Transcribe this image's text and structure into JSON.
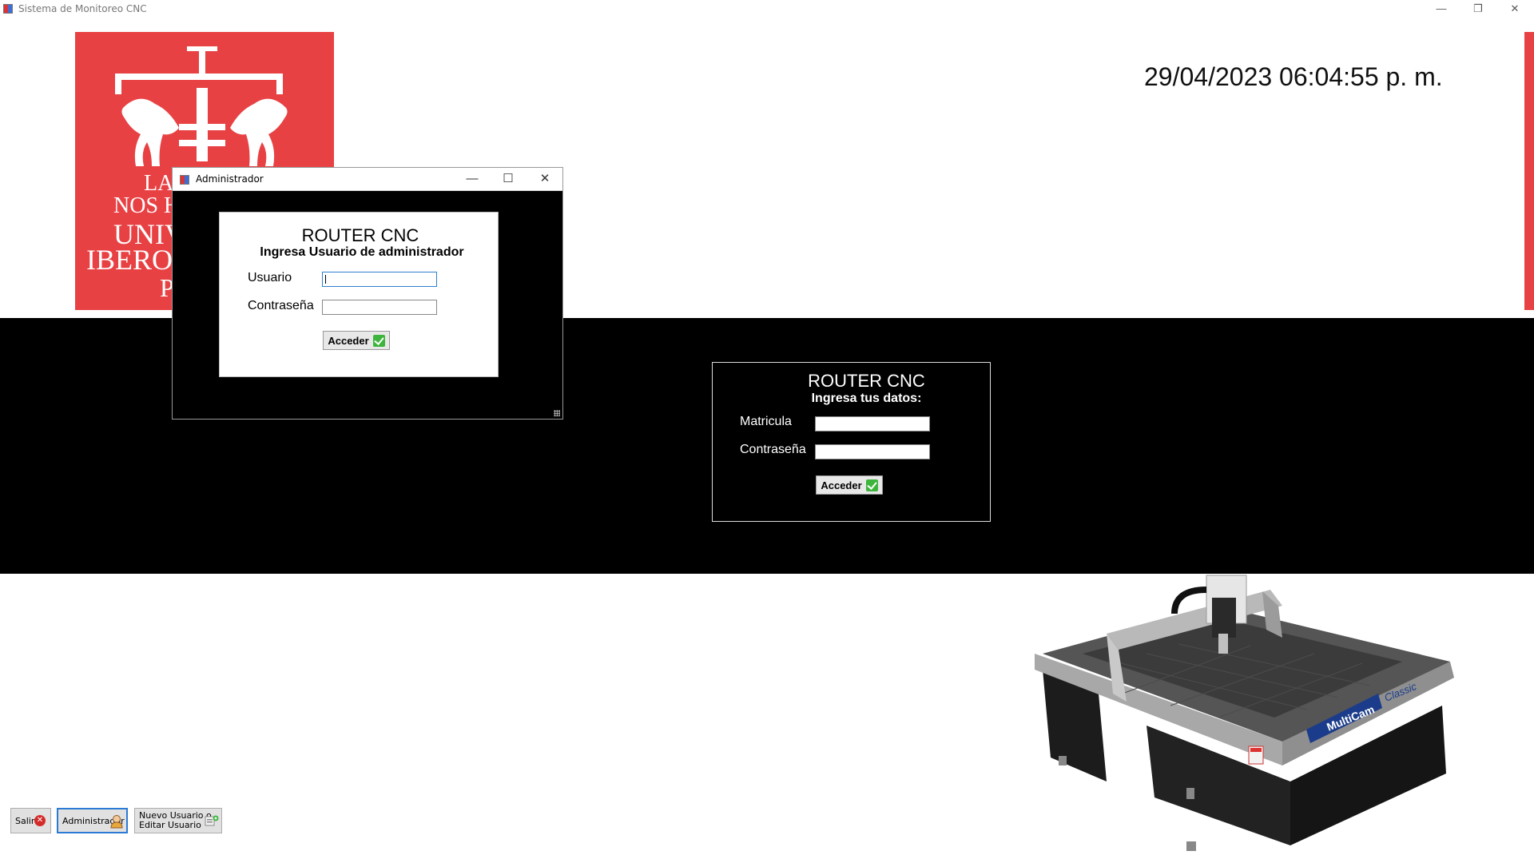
{
  "window": {
    "title": "Sistema de Monitoreo CNC",
    "minimize": "—",
    "restore": "❐",
    "close": "✕"
  },
  "logo": {
    "lines": [
      "LA",
      "NOS H",
      "UNIV",
      "IBEROA",
      "P"
    ]
  },
  "datetime": "29/04/2023 06:04:55 p. m.",
  "login": {
    "title": "ROUTER CNC",
    "subtitle": "Ingresa tus datos:",
    "matricula_label": "Matricula",
    "password_label": "Contraseña",
    "matricula_value": "",
    "password_value": "",
    "submit_label": "Acceder"
  },
  "admin_dialog": {
    "title": "Administrador",
    "minimize": "—",
    "maximize": "☐",
    "close": "✕",
    "panel_title": "ROUTER CNC",
    "panel_subtitle": "Ingresa Usuario de administrador",
    "user_label": "Usuario",
    "password_label": "Contraseña",
    "user_value": "",
    "password_value": "",
    "submit_label": "Acceder"
  },
  "bottom_buttons": {
    "salir": "Salir",
    "administrador": "Administrador",
    "nuevo_line1": "Nuevo Usuario o",
    "nuevo_line2": "Editar Usuario"
  },
  "machine_brand": {
    "name": "MultiCam",
    "model": "Classic"
  },
  "colors": {
    "brand_red": "#e84144",
    "band": "#000000",
    "focus_blue": "#2b7bd4"
  }
}
